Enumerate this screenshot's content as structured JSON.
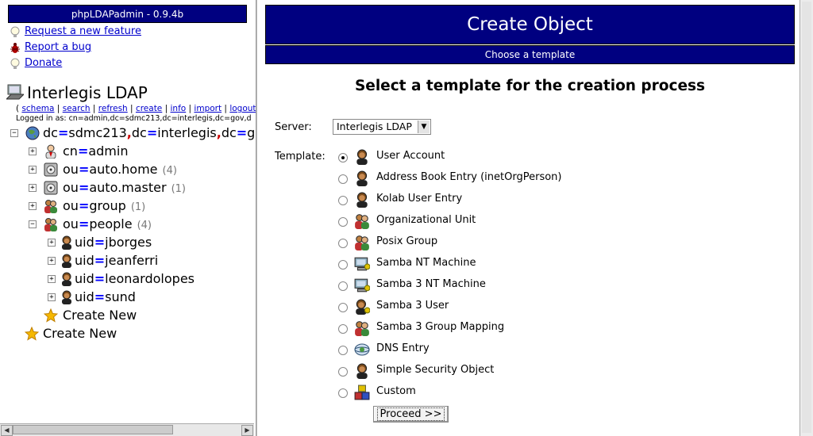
{
  "left": {
    "banner": "phpLDAPadmin - 0.9.4b",
    "quick_links": [
      {
        "label": "Request a new feature",
        "icon": "lightbulb-icon"
      },
      {
        "label": "Report a bug",
        "icon": "bug-icon"
      },
      {
        "label": "Donate",
        "icon": "lightbulb-icon"
      }
    ],
    "server_name": "Interlegis LDAP",
    "server_links": [
      "schema",
      "search",
      "refresh",
      "create",
      "info",
      "import",
      "logout"
    ],
    "logged_in_as": "Logged in as: cn=admin,dc=sdmc213,dc=interlegis,dc=gov,d",
    "tree": {
      "root": {
        "label_parts": [
          "dc",
          "=",
          "sdmc213",
          ",",
          "dc",
          "=",
          "interlegis",
          ",",
          "dc",
          "=",
          "go"
        ],
        "icon": "globe-icon",
        "expander": "−"
      },
      "items": [
        {
          "attr": "cn",
          "value": "admin",
          "count": "",
          "icon": "admin-user-icon",
          "expander": "+"
        },
        {
          "attr": "ou",
          "value": "auto.home",
          "count": "(4)",
          "icon": "drive-icon",
          "expander": "+"
        },
        {
          "attr": "ou",
          "value": "auto.master",
          "count": "(1)",
          "icon": "drive-icon",
          "expander": "+"
        },
        {
          "attr": "ou",
          "value": "group",
          "count": "(1)",
          "icon": "group-icon",
          "expander": "+"
        },
        {
          "attr": "ou",
          "value": "people",
          "count": "(4)",
          "icon": "group-icon",
          "expander": "−"
        }
      ],
      "people": [
        {
          "attr": "uid",
          "value": "jborges"
        },
        {
          "attr": "uid",
          "value": "jeanferri"
        },
        {
          "attr": "uid",
          "value": "leonardolopes"
        },
        {
          "attr": "uid",
          "value": "sund"
        }
      ],
      "create_new_child": "Create New",
      "create_new_root": "Create New"
    }
  },
  "main": {
    "title": "Create Object",
    "subtitle": "Choose a template",
    "heading": "Select a template for the creation process",
    "server_label": "Server:",
    "server_value": "Interlegis LDAP",
    "template_label": "Template:",
    "templates": [
      {
        "label": "User Account",
        "icon": "user-icon",
        "checked": true
      },
      {
        "label": "Address Book Entry (inetOrgPerson)",
        "icon": "user-icon",
        "checked": false
      },
      {
        "label": "Kolab User Entry",
        "icon": "user-icon",
        "checked": false
      },
      {
        "label": "Organizational Unit",
        "icon": "group-icon",
        "checked": false
      },
      {
        "label": "Posix Group",
        "icon": "group-icon",
        "checked": false
      },
      {
        "label": "Samba NT Machine",
        "icon": "computer-icon",
        "checked": false
      },
      {
        "label": "Samba 3 NT Machine",
        "icon": "computer-icon",
        "checked": false
      },
      {
        "label": "Samba 3 User",
        "icon": "samba-user-icon",
        "checked": false
      },
      {
        "label": "Samba 3 Group Mapping",
        "icon": "group-icon",
        "checked": false
      },
      {
        "label": "DNS Entry",
        "icon": "dns-icon",
        "checked": false
      },
      {
        "label": "Simple Security Object",
        "icon": "user-icon",
        "checked": false
      },
      {
        "label": "Custom",
        "icon": "cubes-icon",
        "checked": false
      }
    ],
    "proceed_label": "Proceed >>"
  },
  "colors": {
    "header_bg": "#000080",
    "link": "#0000cc",
    "equals": "#0000ff",
    "comma": "#cc0000"
  }
}
